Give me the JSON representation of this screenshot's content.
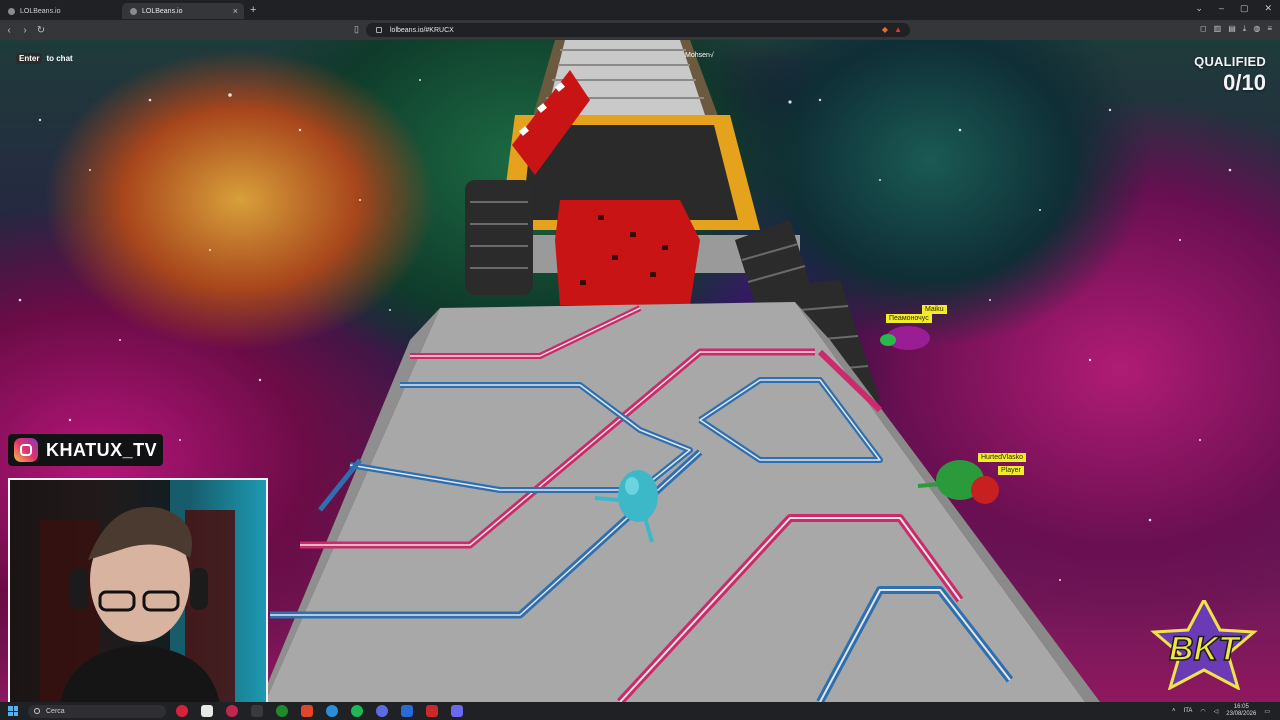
{
  "browser": {
    "tabs": [
      {
        "title": "LOLBeans.io",
        "active": false
      },
      {
        "title": "LOLBeans.io",
        "active": true
      }
    ],
    "new_tab_icon": "plus-icon",
    "url": "lolbeans.io/#KRUCX",
    "window_controls": [
      "minimize-icon",
      "maximize-icon",
      "close-icon"
    ]
  },
  "game": {
    "chat_hint": {
      "key": "Enter",
      "text": "to chat"
    },
    "qualified": {
      "label": "QUALIFIED",
      "count": "0/10"
    },
    "players": [
      {
        "name": "Mohsen√",
        "style": "plain"
      },
      {
        "name": "Maiku",
        "style": "tag"
      },
      {
        "name": "Пеамоночус",
        "style": "tag"
      },
      {
        "name": "HurtedVlasko",
        "style": "tag"
      },
      {
        "name": "Player",
        "style": "tag"
      }
    ]
  },
  "stream_overlay": {
    "instagram_handle": "KHATUX_TV",
    "brand_logo": "BKT"
  },
  "taskbar": {
    "search_placeholder": "Cerca",
    "language": "ITA",
    "time": "16:05",
    "date": "23/08/2026"
  },
  "colors": {
    "track_gray": "#a8a8a8",
    "track_pink": "#cc2a6b",
    "track_blue": "#2d6fb0",
    "rail_orange": "#e5a21c",
    "roller_red": "#c81414",
    "player_bean": "#3cb8c8",
    "accent_yellow": "#f3ec2a"
  }
}
